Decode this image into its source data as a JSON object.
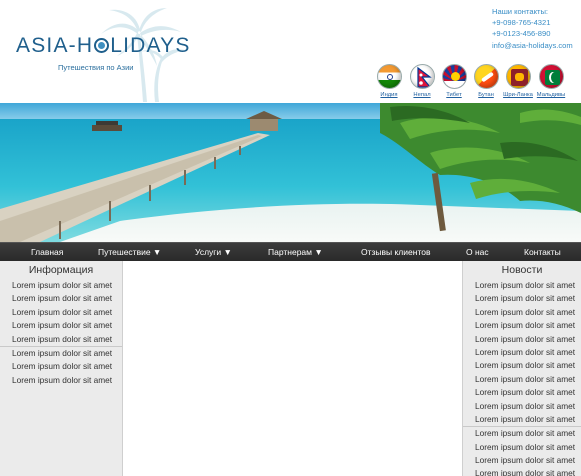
{
  "header": {
    "logo_text_left": "ASIA-H",
    "logo_text_right": "LIDAYS",
    "tagline": "Путешествия по Азии",
    "contacts_title": "Наши контакты:",
    "phone1": "+9-098-765-4321",
    "phone2": "+9-0123-456-890",
    "email": "info@asia-holidays.com"
  },
  "flags": [
    {
      "label": "Индия"
    },
    {
      "label": "Непал"
    },
    {
      "label": "Тибет"
    },
    {
      "label": "Бутан"
    },
    {
      "label": "Шри-Ланка"
    },
    {
      "label": "Мальдивы"
    }
  ],
  "nav": {
    "items": [
      {
        "label": "Главная"
      },
      {
        "label": "Путешествие ▼"
      },
      {
        "label": "Услуги ▼"
      },
      {
        "label": "Партнерам ▼"
      },
      {
        "label": "Отзывы клиентов"
      },
      {
        "label": "О нас"
      },
      {
        "label": "Контакты"
      }
    ]
  },
  "left": {
    "title": "Информация",
    "items": [
      "Lorem ipsum dolor sit amet",
      "Lorem ipsum dolor sit amet",
      "Lorem ipsum dolor sit amet",
      "Lorem ipsum dolor sit amet",
      "Lorem ipsum dolor sit amet",
      "Lorem ipsum dolor sit amet",
      "Lorem ipsum dolor sit amet",
      "Lorem ipsum dolor sit amet"
    ]
  },
  "right": {
    "title": "Новости",
    "items": [
      "Lorem ipsum dolor sit amet",
      "Lorem ipsum dolor sit amet",
      "Lorem ipsum dolor sit amet",
      "Lorem ipsum dolor sit amet",
      "Lorem ipsum dolor sit amet",
      "Lorem ipsum dolor sit amet",
      "Lorem ipsum dolor sit amet",
      "Lorem ipsum dolor sit amet",
      "Lorem ipsum dolor sit amet",
      "Lorem ipsum dolor sit amet",
      "Lorem ipsum dolor sit amet",
      "Lorem ipsum dolor sit amet",
      "Lorem ipsum dolor sit amet",
      "Lorem ipsum dolor sit amet",
      "Lorem ipsum dolor sit amet"
    ]
  },
  "colors": {
    "brand": "#1f5f8c",
    "link": "#3a8ec6",
    "nav_bg": "#333333",
    "sidebar_bg": "#ebebeb"
  }
}
